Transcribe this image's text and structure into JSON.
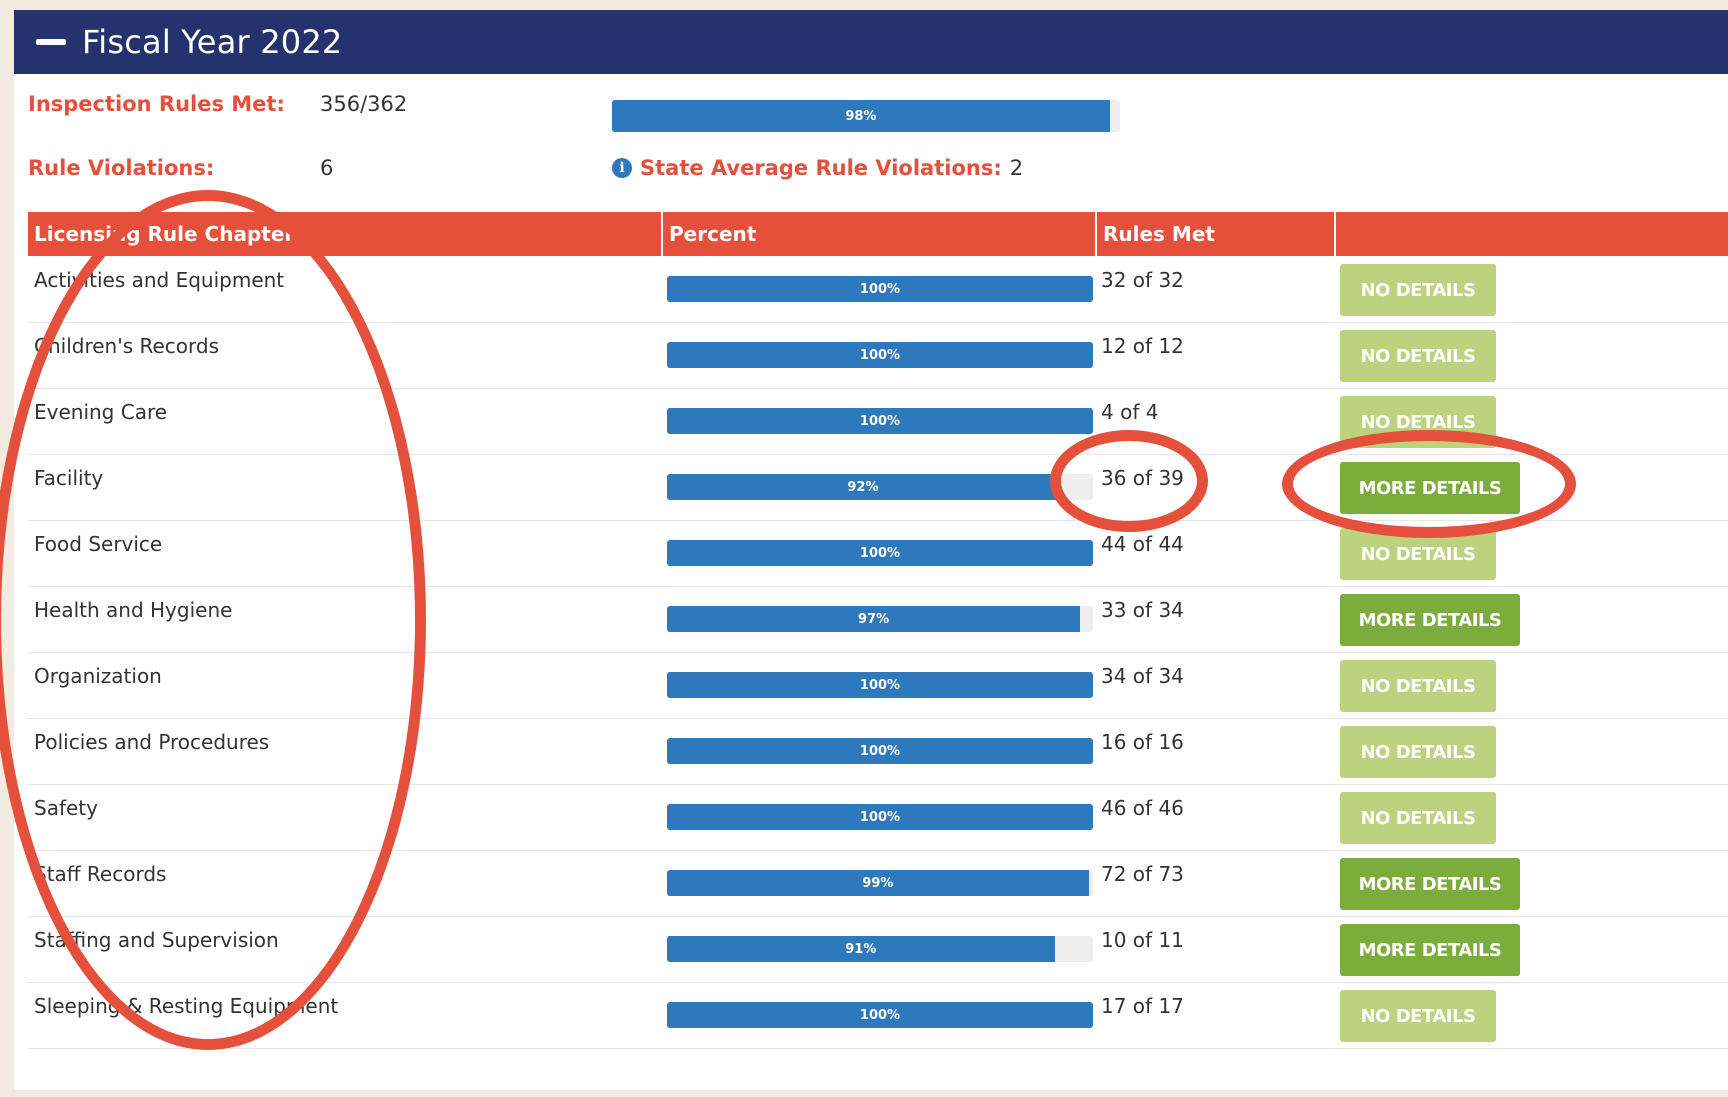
{
  "header": {
    "title": "Fiscal Year 2022"
  },
  "summary": {
    "inspection_label": "Inspection Rules Met:",
    "inspection_value": "356/362",
    "inspection_percent_label": "98%",
    "inspection_percent": 98,
    "violations_label": "Rule Violations:",
    "violations_value": "6",
    "state_avg_label": "State Average Rule Violations:",
    "state_avg_value": "2"
  },
  "table": {
    "headers": [
      "Licensing Rule Chapter",
      "Percent",
      "Rules Met",
      ""
    ],
    "rows": [
      {
        "chapter": "Activities and Equipment",
        "percent": 100,
        "percent_label": "100%",
        "rules_met": "32 of 32",
        "button": "NO DETAILS"
      },
      {
        "chapter": "Children's Records",
        "percent": 100,
        "percent_label": "100%",
        "rules_met": "12 of 12",
        "button": "NO DETAILS"
      },
      {
        "chapter": "Evening Care",
        "percent": 100,
        "percent_label": "100%",
        "rules_met": "4 of 4",
        "button": "NO DETAILS"
      },
      {
        "chapter": "Facility",
        "percent": 92,
        "percent_label": "92%",
        "rules_met": "36 of 39",
        "button": "MORE DETAILS"
      },
      {
        "chapter": "Food Service",
        "percent": 100,
        "percent_label": "100%",
        "rules_met": "44 of 44",
        "button": "NO DETAILS"
      },
      {
        "chapter": "Health and Hygiene",
        "percent": 97,
        "percent_label": "97%",
        "rules_met": "33 of 34",
        "button": "MORE DETAILS"
      },
      {
        "chapter": "Organization",
        "percent": 100,
        "percent_label": "100%",
        "rules_met": "34 of 34",
        "button": "NO DETAILS"
      },
      {
        "chapter": "Policies and Procedures",
        "percent": 100,
        "percent_label": "100%",
        "rules_met": "16 of 16",
        "button": "NO DETAILS"
      },
      {
        "chapter": "Safety",
        "percent": 100,
        "percent_label": "100%",
        "rules_met": "46 of 46",
        "button": "NO DETAILS"
      },
      {
        "chapter": "Staff Records",
        "percent": 99,
        "percent_label": "99%",
        "rules_met": "72 of 73",
        "button": "MORE DETAILS"
      },
      {
        "chapter": "Staffing and Supervision",
        "percent": 91,
        "percent_label": "91%",
        "rules_met": "10 of 11",
        "button": "MORE DETAILS"
      },
      {
        "chapter": "Sleeping & Resting Equipment",
        "percent": 100,
        "percent_label": "100%",
        "rules_met": "17 of 17",
        "button": "NO DETAILS"
      }
    ]
  },
  "colors": {
    "header_bg": "#24336e",
    "accent_red": "#e4503b",
    "bar_blue": "#2e78be",
    "no_details_green": "#bcd27f",
    "more_details_green": "#7cad3c"
  },
  "icons": [
    "collapse-minus-icon",
    "info-icon"
  ]
}
